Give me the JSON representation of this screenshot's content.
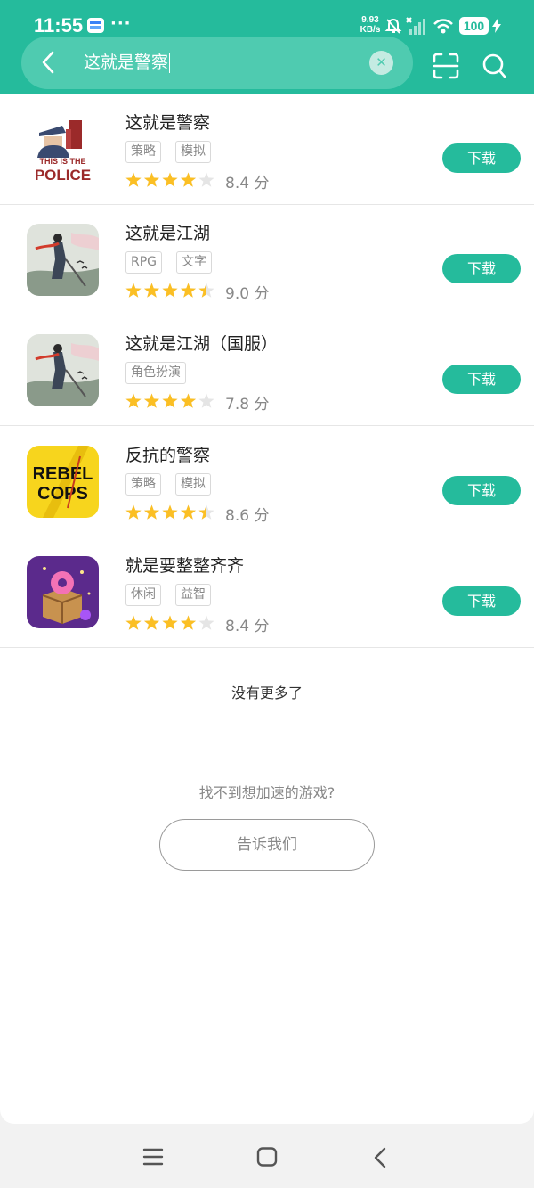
{
  "status_bar": {
    "time": "11:55",
    "dots": "···",
    "net_speed_value": "9.93",
    "net_speed_unit": "KB/s",
    "battery": "100"
  },
  "search": {
    "query": "这就是警察"
  },
  "results": [
    {
      "name": "这就是警察",
      "tags": [
        "策略",
        "模拟"
      ],
      "rating": 4,
      "score": "8.4 分",
      "button": "下载",
      "icon_text_1": "THIS IS THE",
      "icon_text_2": "POLICE"
    },
    {
      "name": "这就是江湖",
      "tags": [
        "RPG",
        "文字"
      ],
      "rating": 4.5,
      "score": "9.0 分",
      "button": "下载"
    },
    {
      "name": "这就是江湖（国服）",
      "tags": [
        "角色扮演"
      ],
      "rating": 4,
      "score": "7.8 分",
      "button": "下载"
    },
    {
      "name": "反抗的警察",
      "tags": [
        "策略",
        "模拟"
      ],
      "rating": 4.5,
      "score": "8.6 分",
      "button": "下载",
      "icon_text_1": "REBEL",
      "icon_text_2": "COPS"
    },
    {
      "name": "就是要整整齐齐",
      "tags": [
        "休闲",
        "益智"
      ],
      "rating": 4,
      "score": "8.4 分",
      "button": "下载"
    }
  ],
  "footer": {
    "no_more": "没有更多了",
    "cant_find": "找不到想加速的游戏?",
    "tell_us": "告诉我们"
  },
  "colors": {
    "accent": "#25bb9c",
    "star": "#fbbf24",
    "star_empty": "#e5e5e5"
  },
  "icons": [
    "back-icon",
    "clear-icon",
    "scan-icon",
    "search-icon",
    "star-icon",
    "menu-icon",
    "home-icon",
    "back-nav-icon"
  ]
}
